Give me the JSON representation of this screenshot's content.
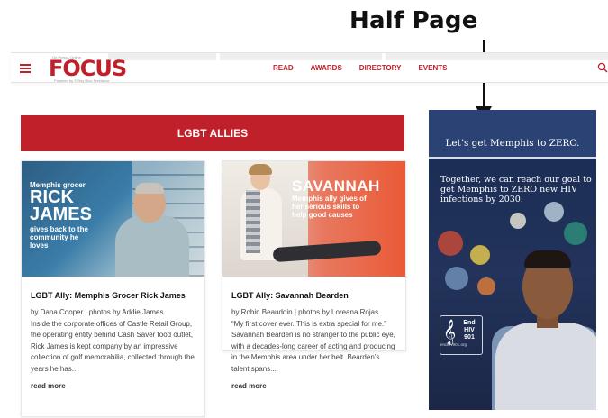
{
  "annotation": {
    "title": "Half Page"
  },
  "nav": {
    "logo": {
      "small": "On Press - Online",
      "main": "FOCUS",
      "tagline": "Powered by © Ray Rico Freelance"
    },
    "links": [
      "READ",
      "AWARDS",
      "DIRECTORY",
      "EVENTS"
    ],
    "icons": {
      "menu": "hamburger-icon",
      "search": "search-icon"
    },
    "accent_color": "#c0202a"
  },
  "section": {
    "title": "LGBT ALLIES"
  },
  "articles": [
    {
      "image_text": {
        "kicker": "Memphis grocer",
        "name_line1": "RICK",
        "name_line2": "JAMES",
        "tail": "gives back to the community he loves"
      },
      "title": "LGBT Ally: Memphis Grocer Rick James",
      "byline": "by Dana Cooper | photos by Addie James",
      "excerpt": "Inside the corporate offices of Castle Retail Group, the operating entity behind Cash Saver food outlet, Rick James is kept company by an impressive collection of golf memorabilia, collected through the years he has...",
      "read_more": "read more"
    },
    {
      "image_text": {
        "name": "SAVANNAH",
        "sub": "Memphis ally gives of her serious skills to help good causes"
      },
      "title": "LGBT Ally: Savannah Bearden",
      "byline": "by Robin Beaudoin | photos by Loreana Rojas",
      "excerpt": "“My first cover ever. This is extra special for me.” Savannah Bearden is no stranger to the public eye, with a decades-long career of acting and producing in the Memphis area under her belt. Bearden’s talent spans...",
      "read_more": "read more"
    }
  ],
  "ad": {
    "headline": "Let’s get Memphis to ZERO.",
    "body": "Together, we can reach our goal to get Memphis to ZERO new HIV infections by 2030.",
    "logo": "End HIV 901",
    "site": "endhiv901.org"
  }
}
